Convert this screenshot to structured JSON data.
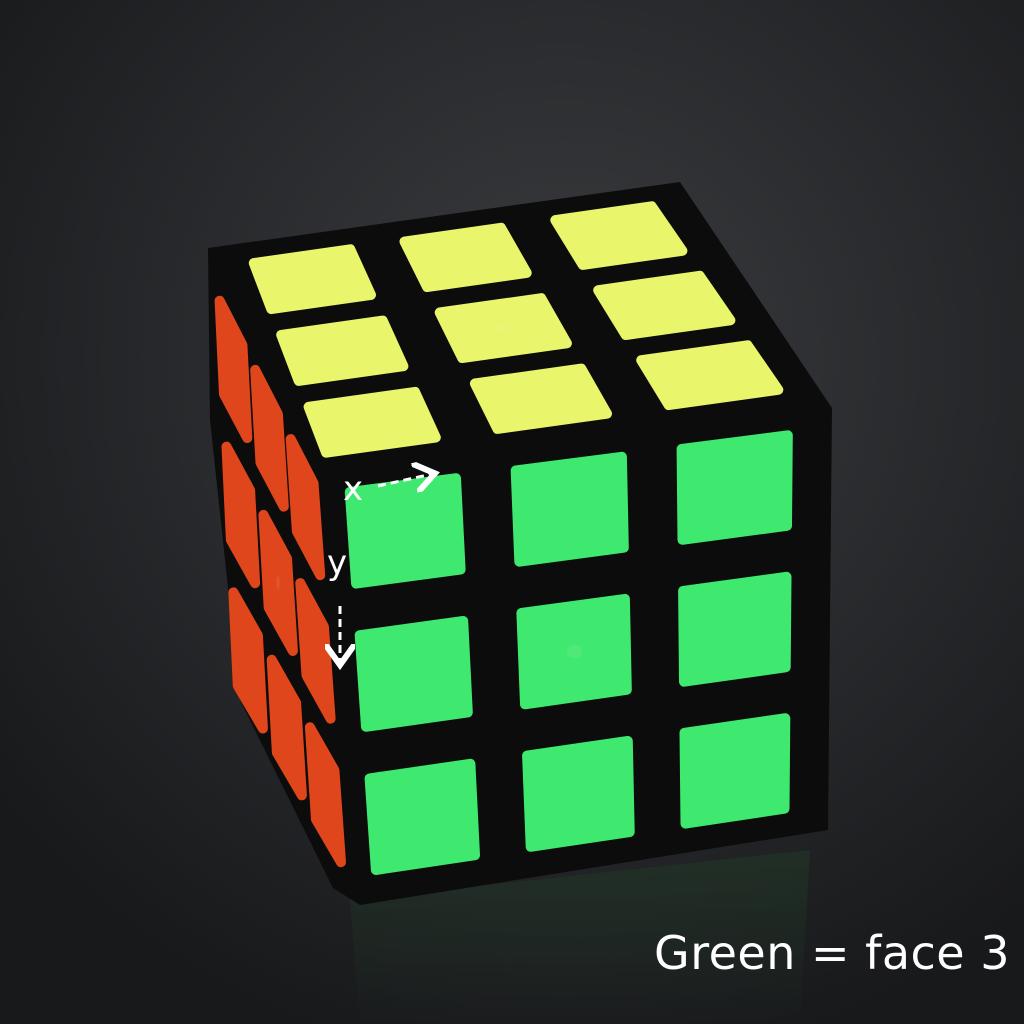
{
  "caption": "Green = face 3",
  "axes": {
    "x": "x",
    "y": "y"
  },
  "colors": {
    "background": "#2a2b2e",
    "cube_body": "#0c0c0d",
    "top_face": "#e9f56a",
    "front_face": "#3fe86e",
    "left_face": "#e0461c",
    "annotation": "#ffffff"
  },
  "cube": {
    "faces": [
      {
        "name": "top",
        "color": "#e9f56a",
        "rows": 3,
        "cols": 3
      },
      {
        "name": "front",
        "color": "#3fe86e",
        "rows": 3,
        "cols": 3
      },
      {
        "name": "left",
        "color": "#e0461c",
        "rows": 3,
        "cols": 3
      }
    ]
  }
}
